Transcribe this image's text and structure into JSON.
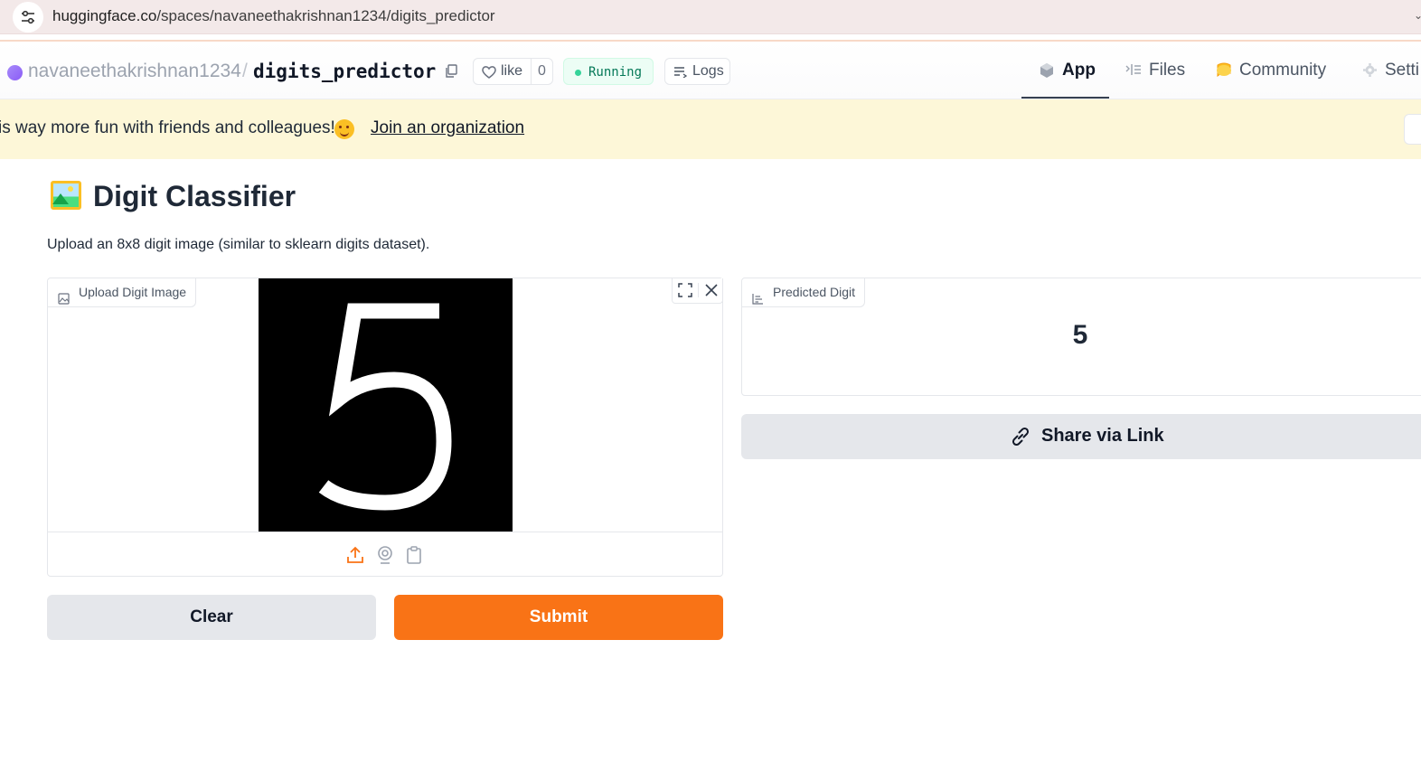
{
  "browser": {
    "url_host": "huggingface.co",
    "url_path": "/spaces/navaneethakrishnan1234/digits_predictor"
  },
  "space_header": {
    "owner": "navaneethakrishnan1234",
    "separator": "/",
    "repo_name": "digits_predictor",
    "like_label": "like",
    "like_count": "0",
    "status": "Running",
    "logs_label": "Logs",
    "tabs": [
      {
        "label": "App",
        "icon": "cube-icon",
        "active": true
      },
      {
        "label": "Files",
        "icon": "files-icon",
        "active": false
      },
      {
        "label": "Community",
        "icon": "community-icon",
        "active": false
      },
      {
        "label": "Setti",
        "icon": "gear-icon",
        "active": false
      }
    ]
  },
  "banner": {
    "text": "is way more fun with friends and colleagues!",
    "emoji": "hugging-face-emoji",
    "link": "Join an organization"
  },
  "app": {
    "title": "Digit Classifier",
    "description": "Upload an 8x8 digit image (similar to sklearn digits dataset).",
    "input_label": "Upload Digit Image",
    "uploaded_digit": "5",
    "output_label": "Predicted Digit",
    "output_value": "5",
    "share_label": "Share via Link",
    "clear_label": "Clear",
    "submit_label": "Submit"
  },
  "colors": {
    "accent": "#f97316",
    "running_green": "#047857",
    "banner_bg": "#fdf7d8"
  }
}
